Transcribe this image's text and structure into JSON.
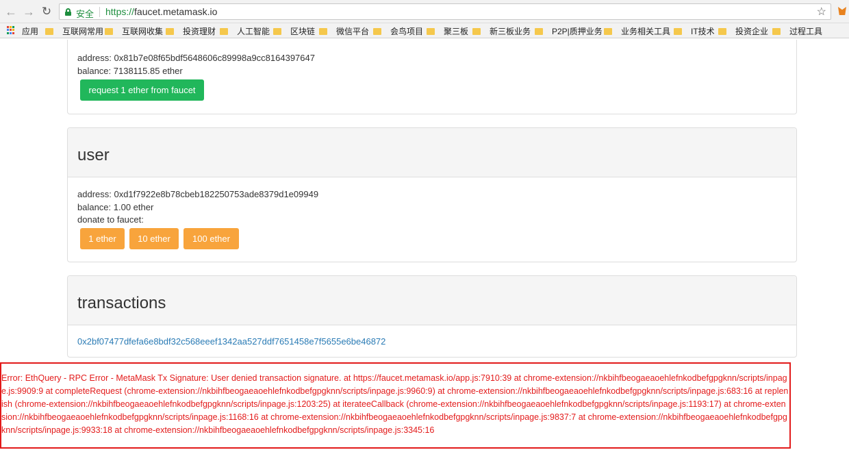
{
  "browser": {
    "security_label": "安全",
    "url_scheme": "https://",
    "url_host": "faucet.metamask.io",
    "apps_label": "应用",
    "bookmarks": [
      "互联网常用",
      "互联网收集",
      "投资理财",
      "人工智能",
      "区块链",
      "微信平台",
      "会鸟项目",
      "聚三板",
      "新三板业务",
      "P2P|质押业务",
      "业务相关工具",
      "IT技术",
      "投资企业",
      "过程工具"
    ]
  },
  "faucet": {
    "address": "address: 0x81b7e08f65bdf5648606c89998a9cc8164397647",
    "balance": "balance: 7138115.85 ether",
    "request_button": "request 1 ether from faucet"
  },
  "user": {
    "heading": "user",
    "address": "address: 0xd1f7922e8b78cbeb182250753ade8379d1e09949",
    "balance": "balance: 1.00 ether",
    "donate_label": "donate to faucet:",
    "donate_buttons": [
      "1 ether",
      "10 ether",
      "100 ether"
    ]
  },
  "transactions": {
    "heading": "transactions",
    "items": [
      "0x2bf07477dfefa6e8bdf32c568eeef1342aa527ddf7651458e7f5655e6be46872"
    ]
  },
  "error": {
    "message": "Error: EthQuery - RPC Error - MetaMask Tx Signature: User denied transaction signature. at https://faucet.metamask.io/app.js:7910:39 at chrome-extension://nkbihfbeogaeaoehlefnkodbefgpgknn/scripts/inpage.js:9909:9 at completeRequest (chrome-extension://nkbihfbeogaeaoehlefnkodbefgpgknn/scripts/inpage.js:9960:9) at chrome-extension://nkbihfbeogaeaoehlefnkodbefgpgknn/scripts/inpage.js:683:16 at replenish (chrome-extension://nkbihfbeogaeaoehlefnkodbefgpgknn/scripts/inpage.js:1203:25) at iterateeCallback (chrome-extension://nkbihfbeogaeaoehlefnkodbefgpgknn/scripts/inpage.js:1193:17) at chrome-extension://nkbihfbeogaeaoehlefnkodbefgpgknn/scripts/inpage.js:1168:16 at chrome-extension://nkbihfbeogaeaoehlefnkodbefgpgknn/scripts/inpage.js:9837:7 at chrome-extension://nkbihfbeogaeaoehlefnkodbefgpgknn/scripts/inpage.js:9933:18 at chrome-extension://nkbihfbeogaeaoehlefnkodbefgpgknn/scripts/inpage.js:3345:16"
  },
  "colors": {
    "accent_green": "#21b75b",
    "accent_orange": "#f8a43c",
    "error_red": "#e31b1b",
    "link_blue": "#2a7bb5"
  }
}
